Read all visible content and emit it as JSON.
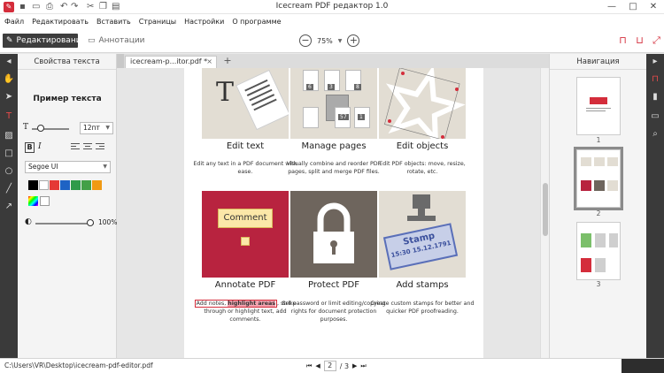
{
  "window": {
    "title": "Icecream PDF редактор 1.0",
    "minimize": "—",
    "maximize": "□",
    "close": "✕"
  },
  "menu": [
    "Файл",
    "Редактировать",
    "Вставить",
    "Страницы",
    "Настройки",
    "О программе"
  ],
  "toolbar": {
    "mode_edit": "Редактирование",
    "mode_annotations": "Аннотации",
    "zoom_value": "75%"
  },
  "left_panel": {
    "title": "Свойства текста",
    "sample": "Пример текста",
    "font_size": "12пт",
    "font_family": "Segoe UI",
    "bold": "B",
    "italic": "I",
    "opacity": "100%",
    "swatch_colors": [
      "#000000",
      "#ffffff",
      "#e53935",
      "#1e63c4",
      "#2f9a4a",
      "#43a047",
      "#f09a14"
    ]
  },
  "tab": {
    "label": "icecream-p...itor.pdf *",
    "close": "×",
    "add": "+"
  },
  "features": [
    {
      "title": "Edit text",
      "desc": "Edit any text in a PDF document with ease."
    },
    {
      "title": "Manage pages",
      "desc": "Visually combine and reorder PDF pages, split and merge PDF files."
    },
    {
      "title": "Edit objects",
      "desc": "Edit PDF objects: move, resize, rotate, etc."
    },
    {
      "title": "Annotate PDF",
      "desc_before": "Add notes, ",
      "desc_highlight": "highlight areas",
      "desc_after": ", strike through or highlight text, add comments."
    },
    {
      "title": "Protect PDF",
      "desc": "Set password or limit editing/copying rights for document protection purposes."
    },
    {
      "title": "Add stamps",
      "desc": "Create custom stamps for better and quicker PDF proofreading."
    }
  ],
  "tile_art": {
    "edit_text_glyph": "T",
    "page_numbers": [
      "6",
      "3",
      "8",
      "57",
      "1"
    ],
    "comment_label": "Comment",
    "stamp_title": "Stamp",
    "stamp_date": "15:30 15.12.1791"
  },
  "nav_panel": {
    "title": "Навигация",
    "pages": [
      "1",
      "2",
      "3"
    ]
  },
  "status": {
    "path": "C:\\Users\\VR\\Desktop\\icecream-pdf-editor.pdf",
    "current_page": "2",
    "total_pages": "/ 3"
  },
  "colors": {
    "accent": "#d42d3b",
    "dark_strip": "#3a3a3a",
    "annotate_bg": "#b8233f",
    "protect_bg": "#6e655d",
    "tile_beige": "#e2ddd3"
  }
}
